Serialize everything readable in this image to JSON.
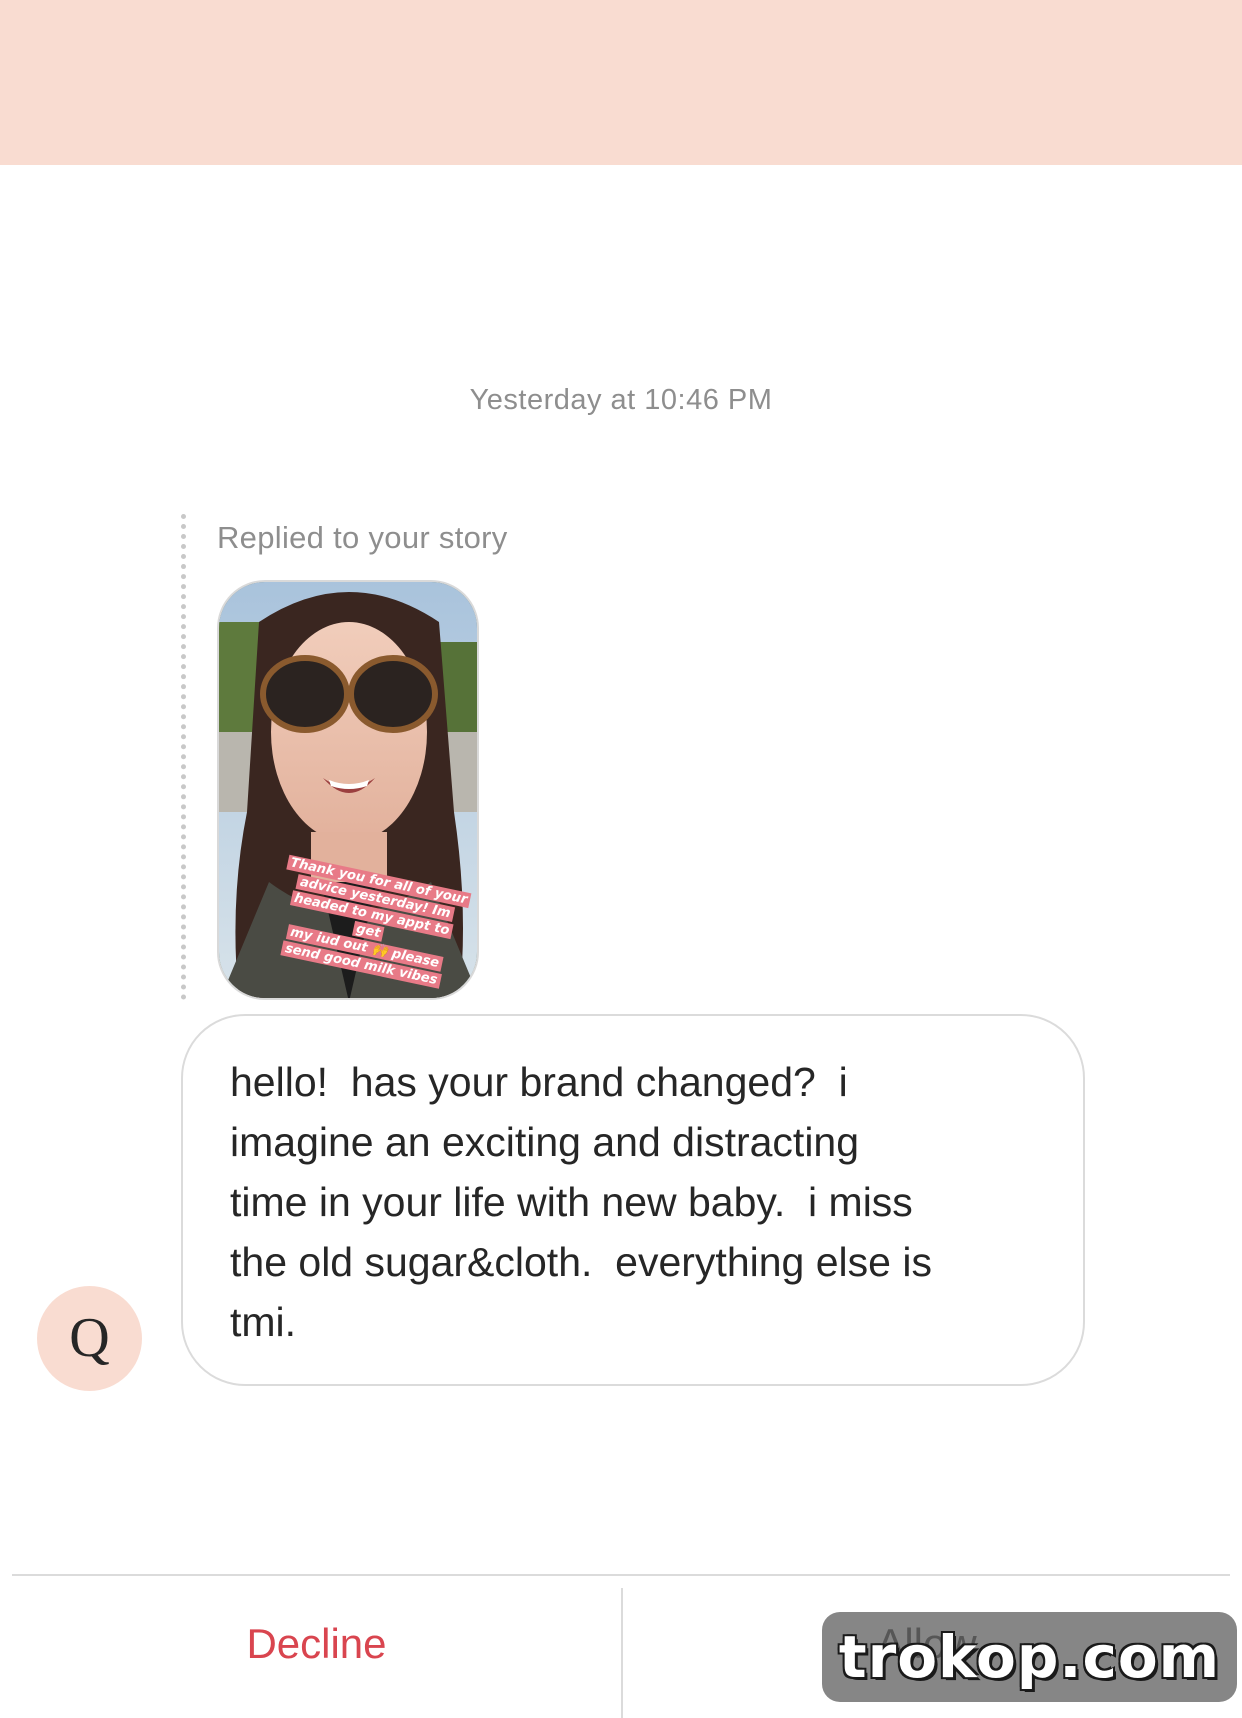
{
  "header": {
    "background_color": "#f9dcd1"
  },
  "conversation": {
    "timestamp": "Yesterday at 10:46 PM",
    "story_reply": {
      "label": "Replied to your story",
      "caption_lines": [
        "Thank you for all of your",
        "advice yesterday! Im",
        "headed to my appt to get",
        "my iud out 🙌 please",
        "send good milk vibes"
      ]
    },
    "message": {
      "text": "hello!  has your brand changed?  i\nimagine an exciting and distracting\ntime in your life with new baby.  i miss\nthe old sugar&cloth.  everything else is\ntmi."
    },
    "sender_avatar": {
      "letter": "Q",
      "background_color": "#f9dcd1"
    }
  },
  "actions": {
    "decline_label": "Decline",
    "allow_label": "Allow",
    "decline_color": "#d9454f"
  },
  "watermark": {
    "text": "trokop.com"
  }
}
